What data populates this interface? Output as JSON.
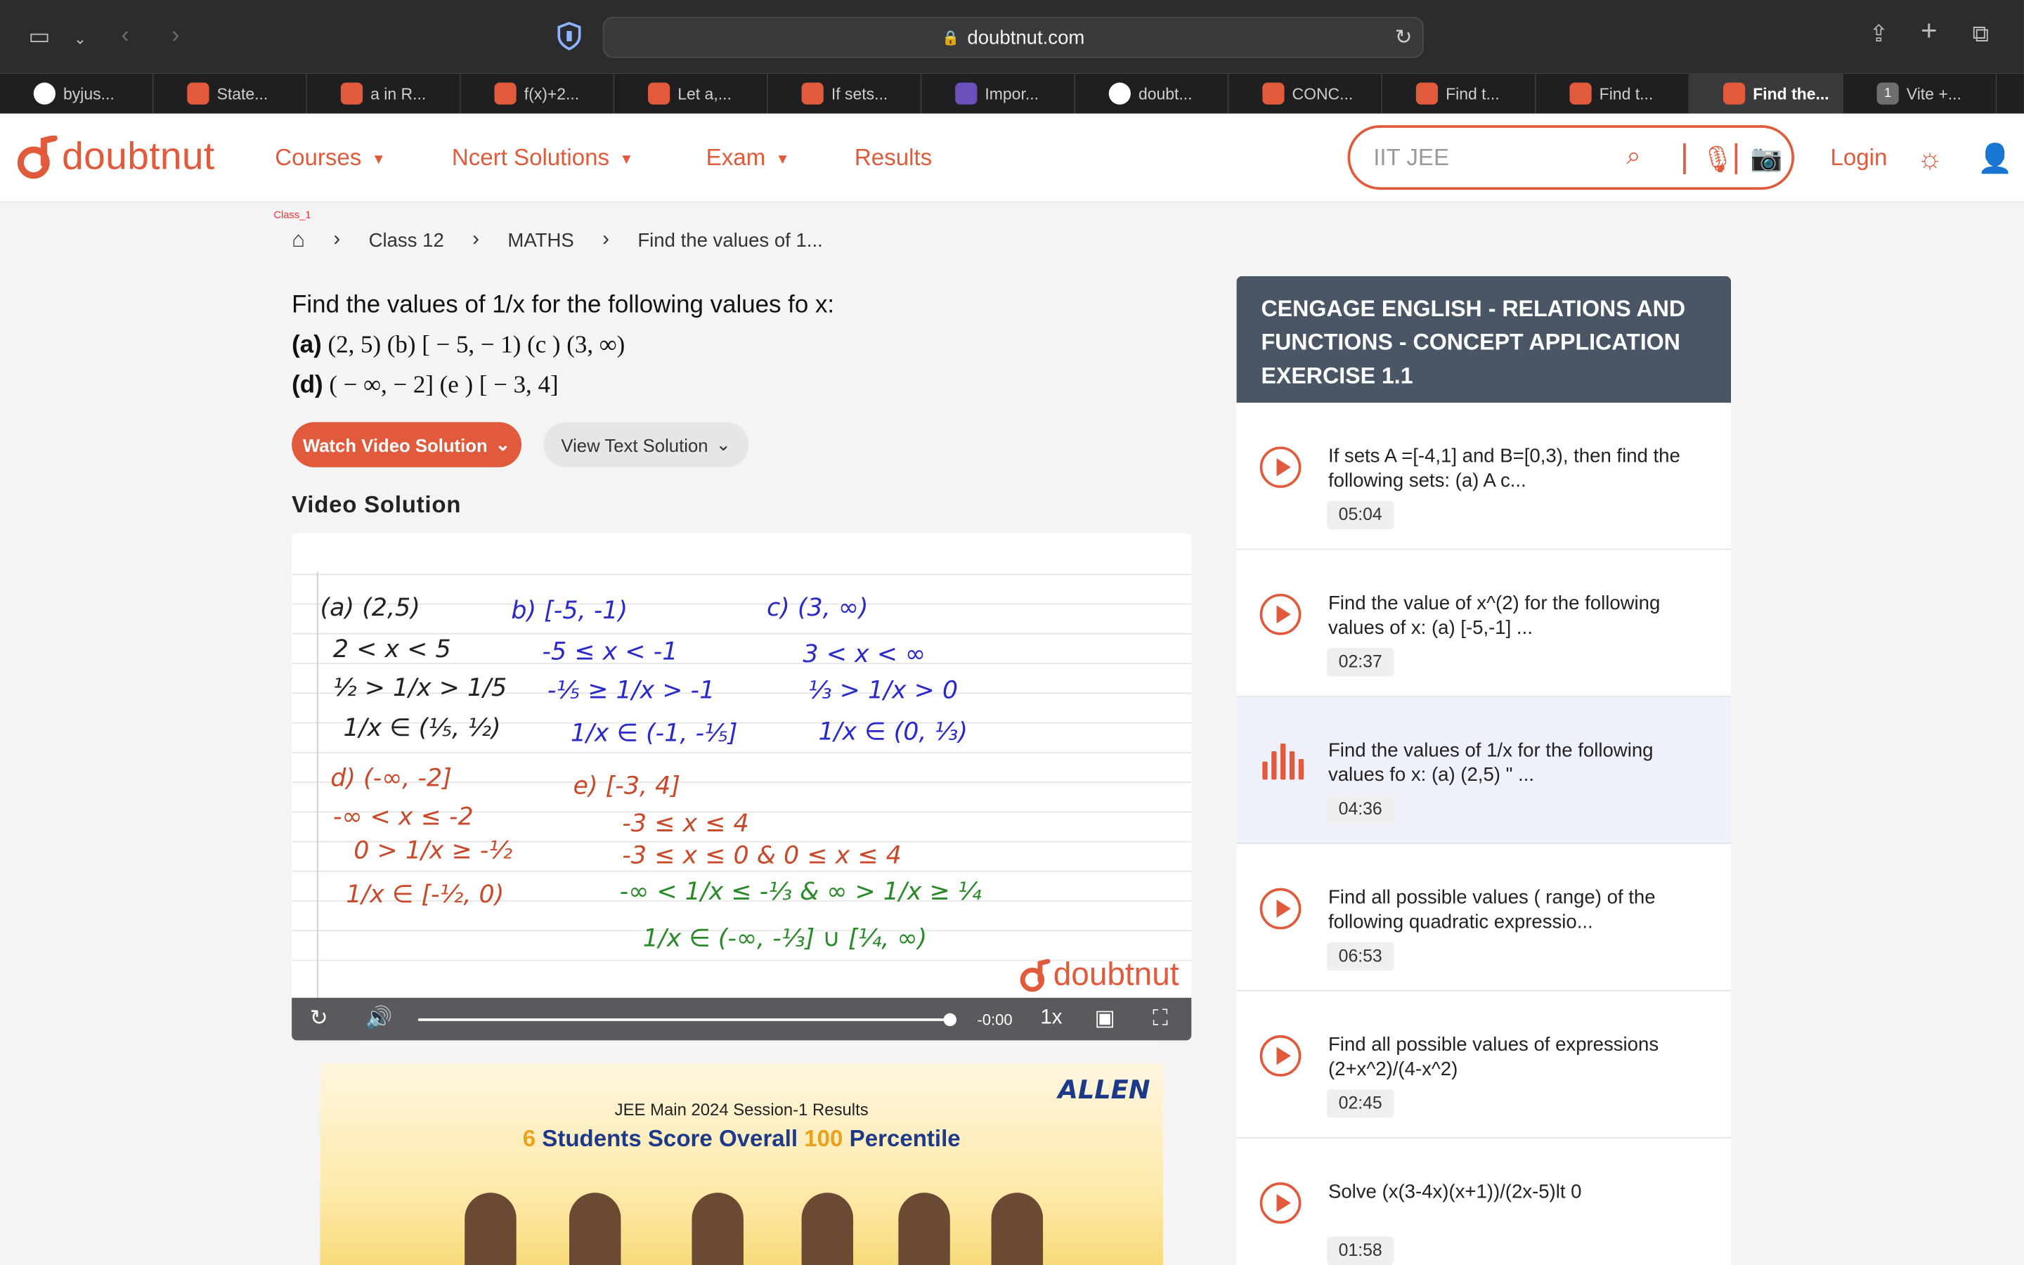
{
  "browser": {
    "url": "doubtnut.com",
    "tabs": [
      {
        "label": "byjus...",
        "fav": "g"
      },
      {
        "label": "State...",
        "fav": "dn"
      },
      {
        "label": "a in R...",
        "fav": "dn"
      },
      {
        "label": "f(x)+2...",
        "fav": "dn"
      },
      {
        "label": "Let a,...",
        "fav": "dn"
      },
      {
        "label": "If sets...",
        "fav": "dn"
      },
      {
        "label": "Impor...",
        "fav": "v"
      },
      {
        "label": "doubt...",
        "fav": "g"
      },
      {
        "label": "CONC...",
        "fav": "dn"
      },
      {
        "label": "Find t...",
        "fav": "dn"
      },
      {
        "label": "Find t...",
        "fav": "dn"
      },
      {
        "label": "Find the...",
        "fav": "dn",
        "active": true
      },
      {
        "label": "Vite +...",
        "fav": "num",
        "num": "1"
      }
    ]
  },
  "header": {
    "logo_text": "doubtnut",
    "nav": {
      "courses": "Courses",
      "ncert": "Ncert Solutions",
      "exam": "Exam",
      "results": "Results"
    },
    "search_placeholder": "IIT JEE",
    "login": "Login"
  },
  "breadcrumb": {
    "tag": "Class_1",
    "items": [
      "Class 12",
      "MATHS",
      "Find the values of 1..."
    ]
  },
  "question": {
    "title": "Find the values of 1/x for the following values fo x:",
    "line1_label": "(a)",
    "line1_math": "(2, 5)   (b)   [ − 5,  − 1)   (c )   (3, ∞)",
    "line2_label": "(d)",
    "line2_math": "( − ∞,  − 2]   (e )   [ − 3, 4]"
  },
  "buttons": {
    "watch": "Watch Video Solution",
    "view_text": "View Text Solution"
  },
  "video": {
    "section_title": "Video Solution",
    "time": "-0:00",
    "speed": "1x",
    "watermark": "doubtnut",
    "progress": 1.0
  },
  "ad": {
    "brand": "ALLEN",
    "line1": "JEE Main 2024 Session-1 Results",
    "line2_pre": "6",
    "line2_mid": " Students Score Overall ",
    "line2_num": "100",
    "line2_post": " Percentile"
  },
  "sidebar": {
    "title": "CENGAGE ENGLISH  -  RELATIONS AND FUNCTIONS  -  CONCEPT APPLICATION EXERCISE 1.1",
    "items": [
      {
        "q": "If sets A =[-4,1] and B=[0,3), then find the following sets: (a) A c...",
        "dur": "05:04"
      },
      {
        "q": "Find the value of x^(2) for the following values of x: (a) [-5,-1] ...",
        "dur": "02:37"
      },
      {
        "q": "Find the values of 1/x for the following values fo x: (a) (2,5) \" ...",
        "dur": "04:36",
        "active": true
      },
      {
        "q": "Find all possible values ( range) of the following quadratic expressio...",
        "dur": "06:53"
      },
      {
        "q": "Find all possible values of expressions (2+x^2)/(4-x^2)",
        "dur": "02:45"
      },
      {
        "q": "Solve (x(3-4x)(x+1))/(2x-5)lt 0",
        "dur": "01:58"
      }
    ]
  },
  "colors": {
    "brand": "#e05a3b",
    "sidebar_head": "#4a5566",
    "highlight_box": "#2fd22f"
  }
}
